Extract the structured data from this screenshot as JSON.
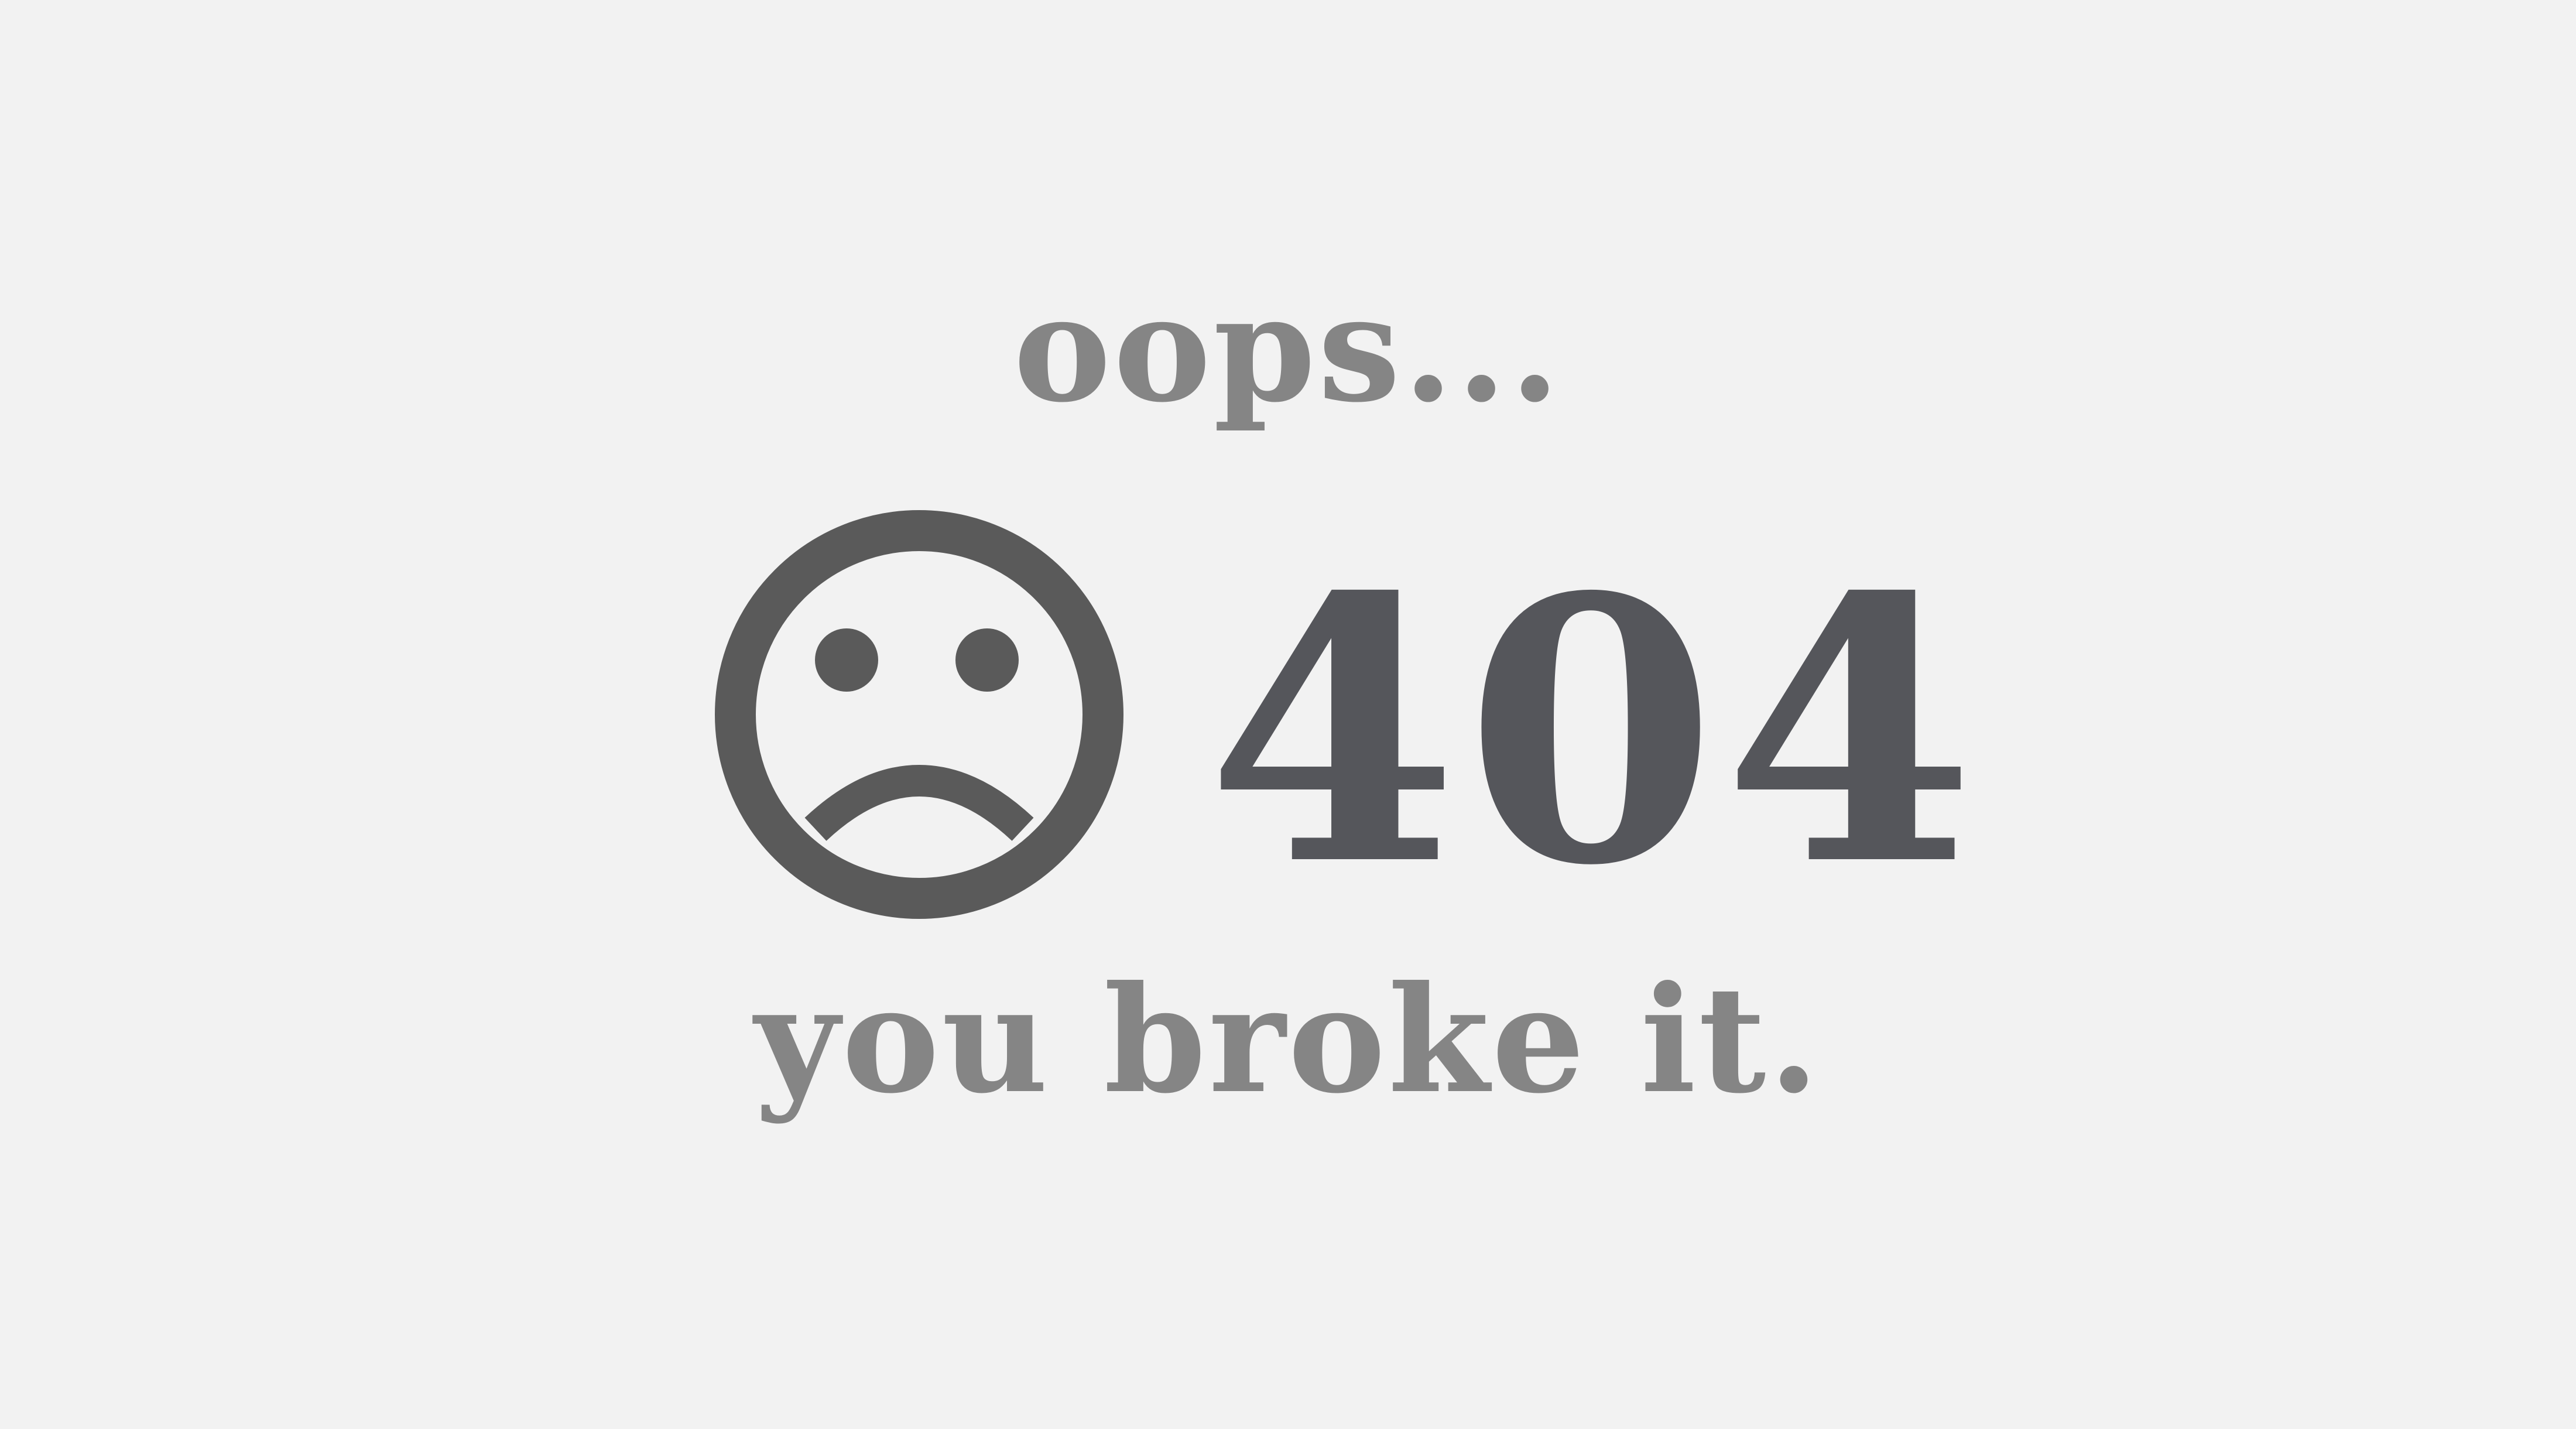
{
  "message": {
    "top_line": "oops...",
    "error_code": "404",
    "bottom_line": "you broke it."
  },
  "icon": {
    "name": "sad-face-icon"
  },
  "colors": {
    "background": "#f2f2f2",
    "secondary_text": "#858585",
    "error_code_text": "#55565b",
    "icon": "#5a5a5a"
  }
}
